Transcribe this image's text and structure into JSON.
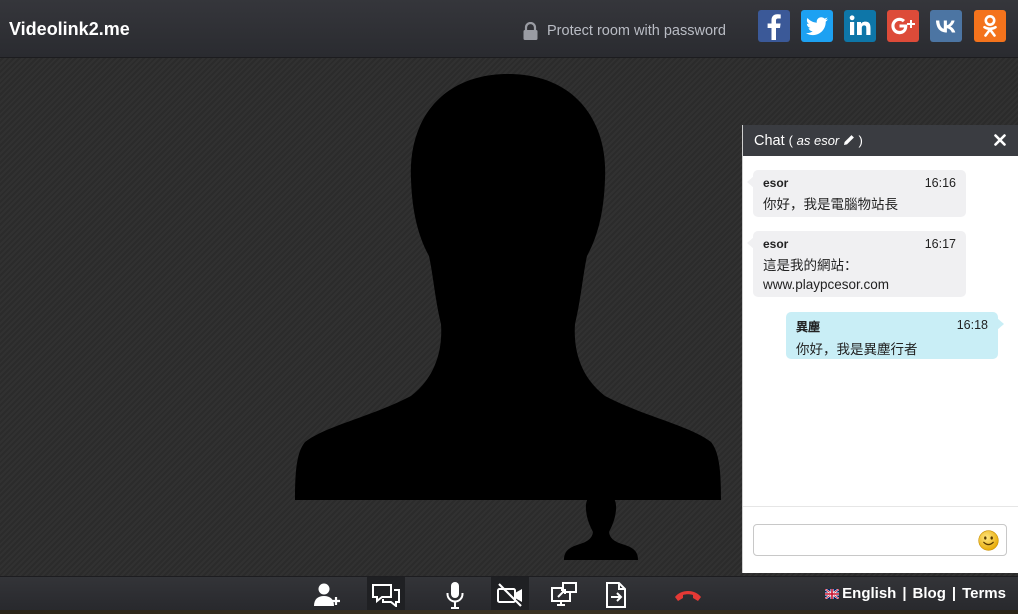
{
  "header": {
    "brand": "Videolink2.me",
    "protect_label": "Protect room with password",
    "social": [
      {
        "icon": "facebook-icon",
        "color": "#3b5998"
      },
      {
        "icon": "twitter-icon",
        "color": "#1da1f2"
      },
      {
        "icon": "linkedin-icon",
        "color": "#0e76a8"
      },
      {
        "icon": "google-plus-icon",
        "color": "#dd4b39"
      },
      {
        "icon": "vk-icon",
        "color": "#4c75a3"
      },
      {
        "icon": "odnoklassniki-icon",
        "color": "#f4731c"
      }
    ]
  },
  "chat": {
    "title": "Chat",
    "as_prefix": "( ",
    "as_word": "as esor",
    "as_suffix": " )",
    "input_placeholder": "",
    "messages": [
      {
        "name": "esor",
        "time": "16:16",
        "text": "你好，我是電腦物站長",
        "direction": "in"
      },
      {
        "name": "esor",
        "time": "16:17",
        "text_lines": [
          "這是我的網站：",
          "www.playpcesor.com"
        ],
        "direction": "in"
      },
      {
        "name": "異塵",
        "time": "16:18",
        "text": "你好，我是異塵行者",
        "direction": "out"
      }
    ]
  },
  "toolbar": {
    "tools": [
      "add-user-icon",
      "chat-icon",
      "microphone-icon",
      "camera-off-icon",
      "screen-share-icon",
      "file-share-icon",
      "hang-up-icon"
    ],
    "active_tools": [
      "chat-icon",
      "camera-off-icon"
    ],
    "hangup_color": "#e53935"
  },
  "footer": {
    "language": "English",
    "sep": "|",
    "blog": "Blog",
    "terms": "Terms"
  },
  "colors": {
    "header_bg": "#2f3035",
    "chat_out_bubble": "#c9eef6",
    "chat_in_bubble": "#f0f0f2"
  }
}
